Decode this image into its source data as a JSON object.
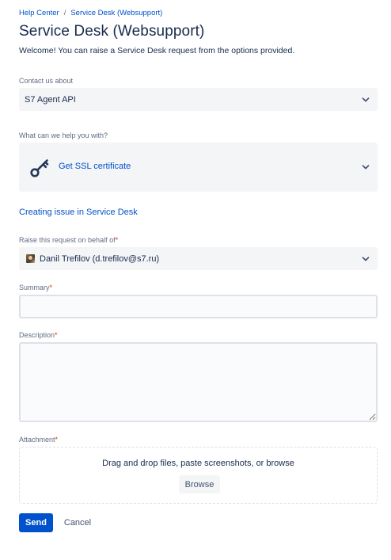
{
  "breadcrumb": {
    "items": [
      "Help Center",
      "Service Desk (Websupport)"
    ],
    "separator": "/"
  },
  "header": {
    "title": "Service Desk (Websupport)",
    "welcome": "Welcome! You can raise a Service Desk request from the options provided."
  },
  "form": {
    "contact": {
      "label": "Contact us about",
      "value": "S7 Agent API"
    },
    "request_type": {
      "label": "What can we help you with?",
      "value": "Get SSL certificate",
      "icon": "key-icon"
    },
    "issue_link": "Creating issue in Service Desk",
    "on_behalf": {
      "label": "Raise this request on behalf of",
      "required_mark": "*",
      "value": "Danil Trefilov (d.trefilov@s7.ru)"
    },
    "summary": {
      "label": "Summary",
      "required_mark": "*",
      "value": ""
    },
    "description": {
      "label": "Description",
      "required_mark": "*",
      "value": ""
    },
    "attachment": {
      "label": "Attachment",
      "required_mark": "*",
      "hint": "Drag and drop files, paste screenshots, or browse",
      "browse_label": "Browse"
    }
  },
  "actions": {
    "send_label": "Send",
    "cancel_label": "Cancel"
  },
  "colors": {
    "link": "#0052cc",
    "primary_button": "#0052cc",
    "required": "#de350b",
    "field_background": "#f4f5f7"
  }
}
